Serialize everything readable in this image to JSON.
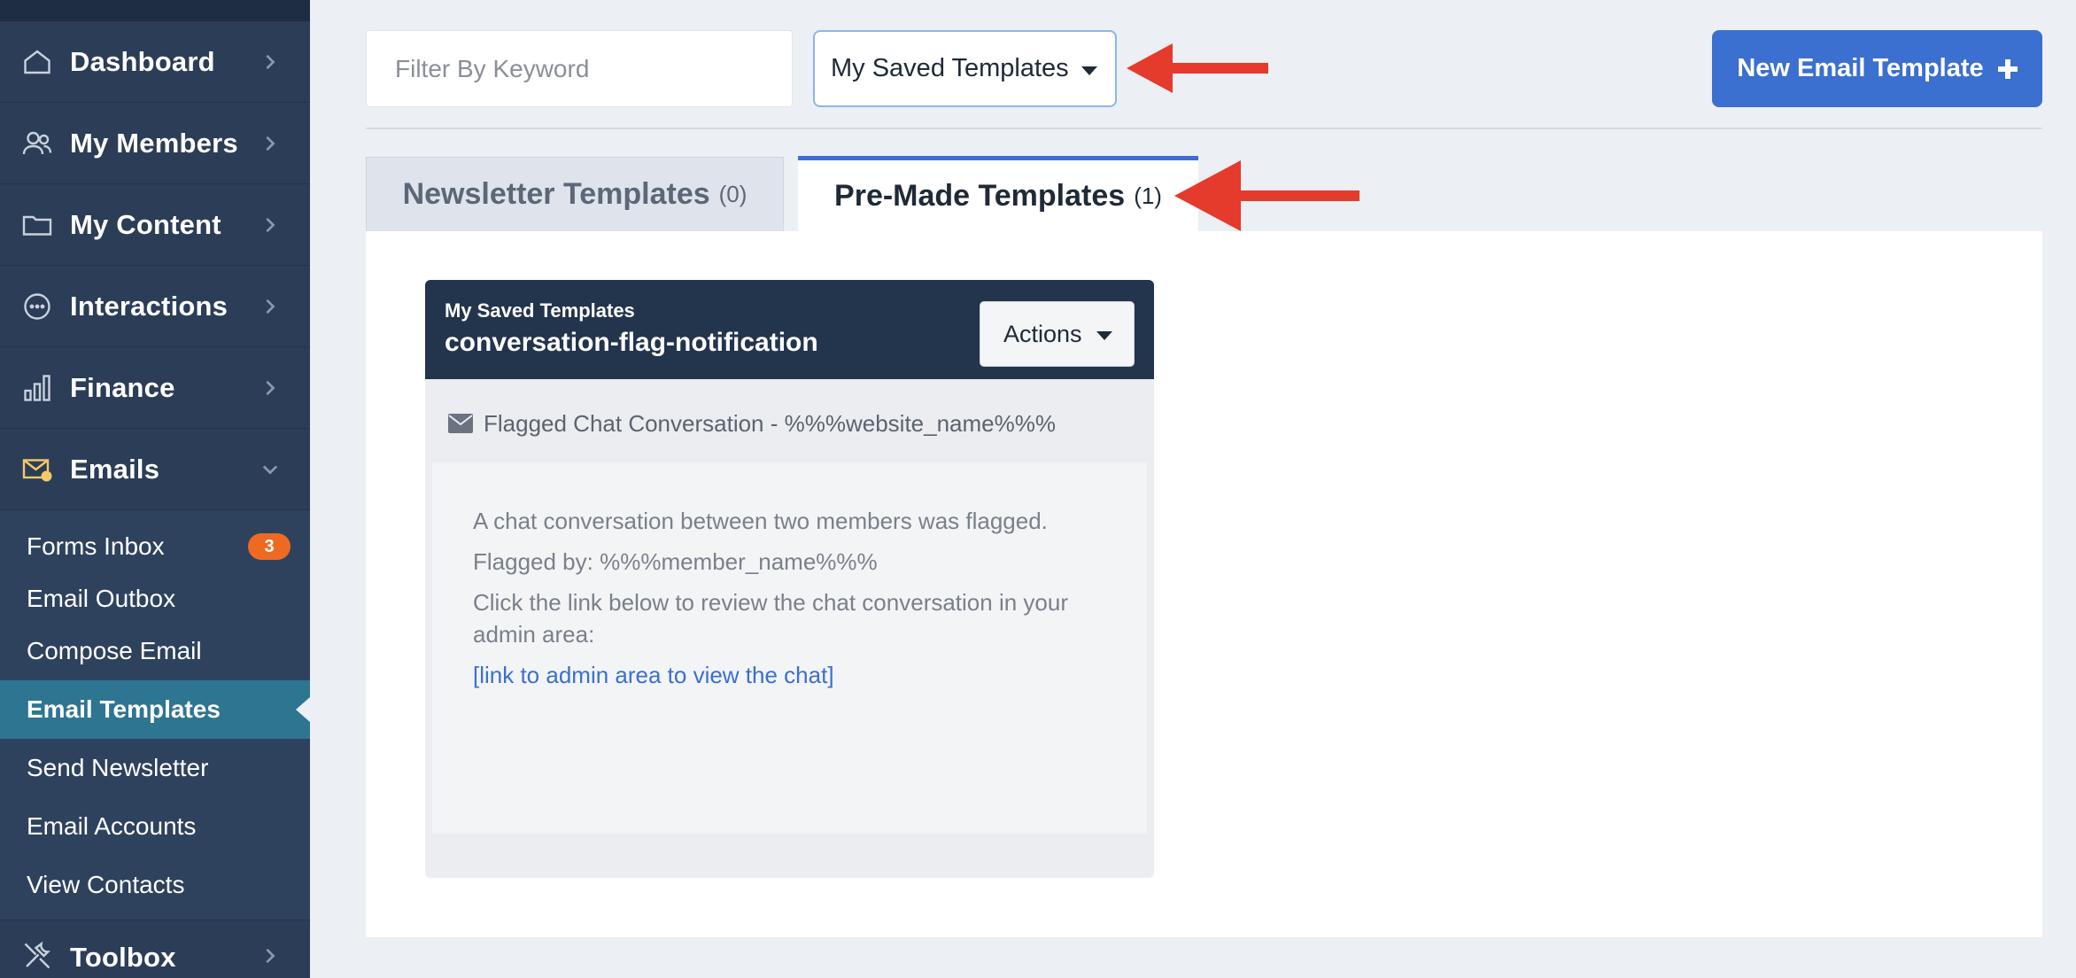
{
  "sidebar": {
    "nav": [
      {
        "label": "Dashboard",
        "icon": "home-icon"
      },
      {
        "label": "My Members",
        "icon": "users-icon"
      },
      {
        "label": "My Content",
        "icon": "folder-icon"
      },
      {
        "label": "Interactions",
        "icon": "chat-icon"
      },
      {
        "label": "Finance",
        "icon": "bar-chart-icon"
      },
      {
        "label": "Emails",
        "icon": "email-icon"
      }
    ],
    "emails_submenu": [
      {
        "label": "Forms Inbox",
        "badge": "3"
      },
      {
        "label": "Email Outbox"
      },
      {
        "label": "Compose Email"
      },
      {
        "label": "Email Templates",
        "active": true
      },
      {
        "label": "Send Newsletter"
      },
      {
        "label": "Email Accounts"
      },
      {
        "label": "View Contacts"
      }
    ],
    "toolbox": {
      "label": "Toolbox",
      "icon": "tools-icon"
    }
  },
  "toolbar": {
    "filter_placeholder": "Filter By Keyword",
    "template_select": "My Saved Templates",
    "new_button": "New Email Template"
  },
  "tabs": [
    {
      "label": "Newsletter Templates",
      "count": "(0)"
    },
    {
      "label": "Pre-Made Templates",
      "count": "(1)",
      "active": true
    }
  ],
  "template_card": {
    "kicker": "My Saved Templates",
    "name": "conversation-flag-notification",
    "actions_label": "Actions",
    "subject": "Flagged Chat Conversation - %%%website_name%%%",
    "body_lines": [
      "A chat conversation between two members was flagged.",
      "Flagged by: %%%member_name%%%",
      "Click the link below to review the chat conversation in your admin area:"
    ],
    "link_text": "[link to admin area to view the chat]"
  },
  "colors": {
    "sidebar_bg": "#2b3d57",
    "active_item": "#2e7592",
    "accent": "#3b6fd0",
    "badge": "#ee6a22",
    "arrow": "#e53b2c"
  }
}
